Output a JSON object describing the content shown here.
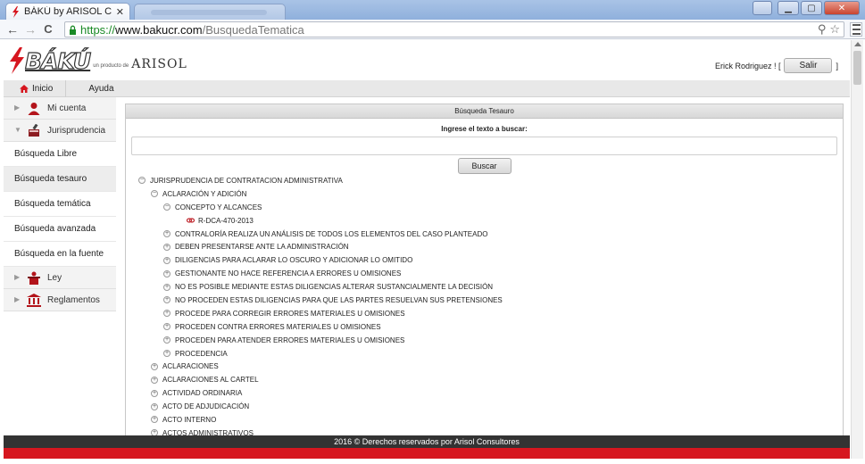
{
  "browser": {
    "tab_title": "BÁKÚ by ARISOL Consulto",
    "tab_close": "✕",
    "url_scheme": "https://",
    "url_host": "www.bakucr.com",
    "url_path": "/BusquedaTematica",
    "accent_color": "#1a8a26"
  },
  "header": {
    "logo_text": "BÁKÚ",
    "logo_tagline": "un producto de",
    "logo_company": "ARISOL",
    "user_prefix": "Erick Rodriguez ! [",
    "logout_label": "Salir",
    "user_suffix": "]"
  },
  "menu": {
    "home_label": "Inicio",
    "help_label": "Ayuda"
  },
  "sidebar": {
    "groups": [
      {
        "label": "Mi cuenta",
        "icon": "user-icon"
      },
      {
        "label": "Jurisprudencia",
        "icon": "gavel-book-icon"
      }
    ],
    "links": [
      {
        "label": "Búsqueda Libre"
      },
      {
        "label": "Búsqueda tesauro"
      },
      {
        "label": "Búsqueda temática"
      },
      {
        "label": "Búsqueda avanzada"
      },
      {
        "label": "Búsqueda en la fuente"
      }
    ],
    "groups2": [
      {
        "label": "Ley",
        "icon": "podium-icon"
      },
      {
        "label": "Reglamentos",
        "icon": "building-icon"
      }
    ]
  },
  "panel": {
    "title": "Búsqueda Tesauro",
    "search_label": "Ingrese el texto a buscar:",
    "search_value": "",
    "search_button": "Buscar"
  },
  "tree": [
    {
      "label": "JURISPRUDENCIA DE CONTRATACION ADMINISTRATIVA",
      "level": 0,
      "state": "open"
    },
    {
      "label": "ACLARACIÓN Y ADICIÓN",
      "level": 1,
      "state": "open"
    },
    {
      "label": "CONCEPTO Y ALCANCES",
      "level": 2,
      "state": "open"
    },
    {
      "label": "R-DCA-470-2013",
      "level": 3,
      "state": "doc"
    },
    {
      "label": "CONTRALORÍA REALIZA UN ANÁLISIS DE TODOS LOS ELEMENTOS DEL CASO PLANTEADO",
      "level": 2,
      "state": "closed"
    },
    {
      "label": "DEBEN PRESENTARSE ANTE LA ADMINISTRACIÓN",
      "level": 2,
      "state": "closed"
    },
    {
      "label": "DILIGENCIAS PARA ACLARAR LO OSCURO Y ADICIONAR LO OMITIDO",
      "level": 2,
      "state": "closed"
    },
    {
      "label": "GESTIONANTE NO HACE REFERENCIA A ERRORES U OMISIONES",
      "level": 2,
      "state": "closed"
    },
    {
      "label": "NO ES POSIBLE MEDIANTE ESTAS DILIGENCIAS ALTERAR SUSTANCIALMENTE LA DECISIÓN",
      "level": 2,
      "state": "closed"
    },
    {
      "label": "NO PROCEDEN ESTAS DILIGENCIAS PARA QUE LAS PARTES RESUELVAN SUS PRETENSIONES",
      "level": 2,
      "state": "closed"
    },
    {
      "label": "PROCEDE PARA CORREGIR ERRORES MATERIALES U OMISIONES",
      "level": 2,
      "state": "closed"
    },
    {
      "label": "PROCEDEN CONTRA ERRORES MATERIALES U OMISIONES",
      "level": 2,
      "state": "closed"
    },
    {
      "label": "PROCEDEN PARA ATENDER ERRORES MATERIALES U OMISIONES",
      "level": 2,
      "state": "closed"
    },
    {
      "label": "PROCEDENCIA",
      "level": 2,
      "state": "closed"
    },
    {
      "label": "ACLARACIONES",
      "level": 1,
      "state": "closed"
    },
    {
      "label": "ACLARACIONES AL CARTEL",
      "level": 1,
      "state": "closed"
    },
    {
      "label": "ACTIVIDAD ORDINARIA",
      "level": 1,
      "state": "closed"
    },
    {
      "label": "ACTO DE ADJUDICACIÓN",
      "level": 1,
      "state": "closed"
    },
    {
      "label": "ACTO INTERNO",
      "level": 1,
      "state": "closed"
    },
    {
      "label": "ACTOS ADMINISTRATIVOS",
      "level": 1,
      "state": "closed"
    }
  ],
  "footer": {
    "text": "2016 © Derechos reservados por Arisol Consultores",
    "bar_color": "#333333",
    "accent_bar_color": "#d6161f"
  }
}
